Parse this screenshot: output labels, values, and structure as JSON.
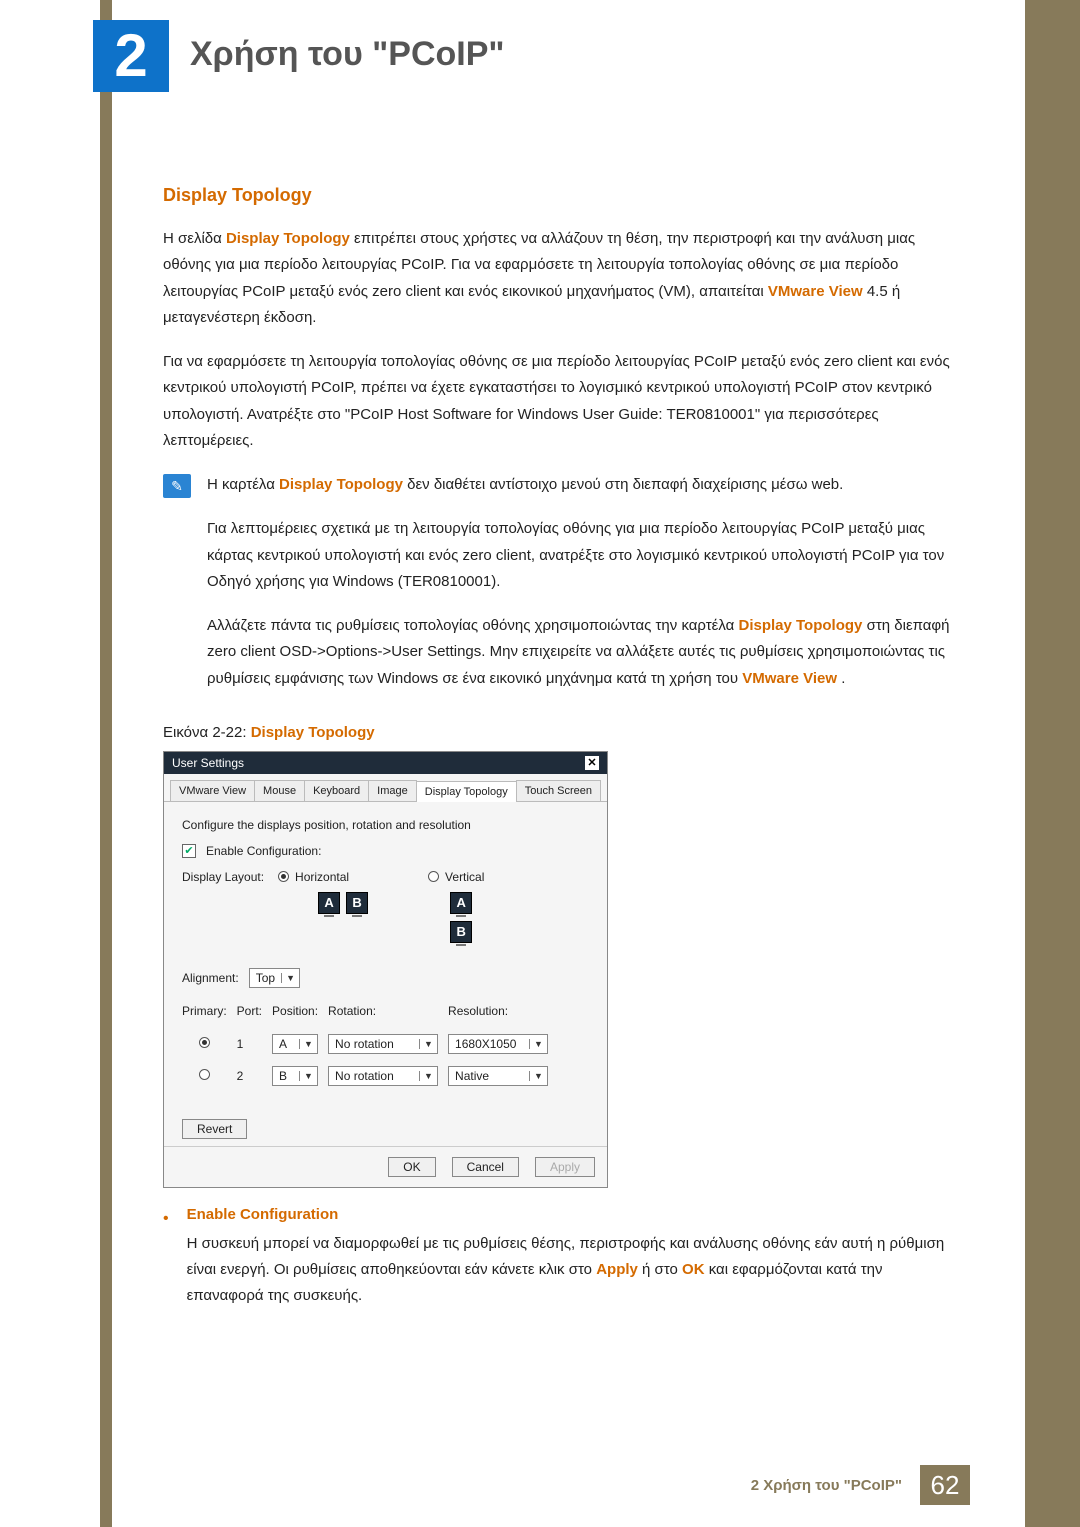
{
  "chapter": {
    "number": "2",
    "title": "Χρήση του \"PCoIP\""
  },
  "section": {
    "heading": "Display Topology"
  },
  "para1": {
    "a": "Η σελίδα ",
    "b": "Display Topology",
    "c": " επιτρέπει στους χρήστες να αλλάζουν τη θέση, την περιστροφή και την ανάλυση μιας οθόνης για μια περίοδο λειτουργίας PCoIP. Για να εφαρμόσετε τη λειτουργία τοπολογίας οθόνης σε μια περίοδο λειτουργίας PCoIP μεταξύ ενός zero client και ενός εικονικού μηχανήματος (VM), απαιτείται ",
    "d": "VMware View",
    "e": " 4.5 ή μεταγενέστερη έκδοση."
  },
  "para2": "Για να εφαρμόσετε τη λειτουργία τοπολογίας οθόνης σε μια περίοδο λειτουργίας PCoIP μεταξύ ενός zero client και ενός κεντρικού υπολογιστή PCoIP, πρέπει να έχετε εγκαταστήσει το λογισμικό κεντρικού υπολογιστή PCoIP στον κεντρικό υπολογιστή. Ανατρέξτε στο \"PCoIP Host Software for Windows User Guide: TER0810001\" για περισσότερες λεπτομέρειες.",
  "note": {
    "n1a": "Η καρτέλα ",
    "n1b": "Display Topology",
    "n1c": " δεν διαθέτει αντίστοιχο μενού στη διεπαφή διαχείρισης μέσω web.",
    "n2": "Για λεπτομέρειες σχετικά με τη λειτουργία τοπολογίας οθόνης για μια περίοδο λειτουργίας PCoIP μεταξύ μιας κάρτας κεντρικού υπολογιστή και ενός zero client, ανατρέξτε στο λογισμικό κεντρικού υπολογιστή PCoIP για τον Οδηγό χρήσης για Windows (TER0810001).",
    "n3a": "Αλλάζετε πάντα τις ρυθμίσεις τοπολογίας οθόνης χρησιμοποιώντας την καρτέλα ",
    "n3b": "Display Topology",
    "n3c": " στη διεπαφή zero client OSD->Options->User Settings. Μην επιχειρείτε να αλλάξετε αυτές τις ρυθμίσεις χρησιμοποιώντας τις ρυθμίσεις εμφάνισης των Windows σε ένα εικονικό μηχάνημα κατά τη χρήση του ",
    "n3d": "VMware View",
    "n3e": "."
  },
  "figureCaption": {
    "prefix": "Εικόνα 2-22: ",
    "name": "Display Topology"
  },
  "dialog": {
    "title": "User Settings",
    "close": "✕",
    "tabs": [
      "VMware View",
      "Mouse",
      "Keyboard",
      "Image",
      "Display Topology",
      "Touch Screen"
    ],
    "activeTab": 4,
    "instruction": "Configure the displays position, rotation and resolution",
    "enableLabel": "Enable Configuration:",
    "displayLayoutLabel": "Display Layout:",
    "horizontal": "Horizontal",
    "vertical": "Vertical",
    "monA": "A",
    "monB": "B",
    "alignment": {
      "label": "Alignment:",
      "value": "Top"
    },
    "columns": {
      "primary": "Primary:",
      "port": "Port:",
      "position": "Position:",
      "rotation": "Rotation:",
      "resolution": "Resolution:"
    },
    "rows": [
      {
        "primary": true,
        "port": "1",
        "position": "A",
        "rotation": "No rotation",
        "resolution": "1680X1050"
      },
      {
        "primary": false,
        "port": "2",
        "position": "B",
        "rotation": "No rotation",
        "resolution": "Native"
      }
    ],
    "revert": "Revert",
    "ok": "OK",
    "cancel": "Cancel",
    "apply": "Apply"
  },
  "bullet": {
    "heading": "Enable Configuration",
    "text_a": "Η συσκευή μπορεί να διαμορφωθεί με τις ρυθμίσεις θέσης, περιστροφής και ανάλυσης οθόνης εάν αυτή η ρύθμιση είναι ενεργή. Οι ρυθμίσεις αποθηκεύονται εάν κάνετε κλικ στο ",
    "text_b": "Apply",
    "text_c": " ή στο ",
    "text_d": "OK",
    "text_e": " και εφαρμόζονται κατά την επαναφορά της συσκευής."
  },
  "footer": {
    "text": "2 Χρήση του \"PCoIP\"",
    "page": "62"
  }
}
